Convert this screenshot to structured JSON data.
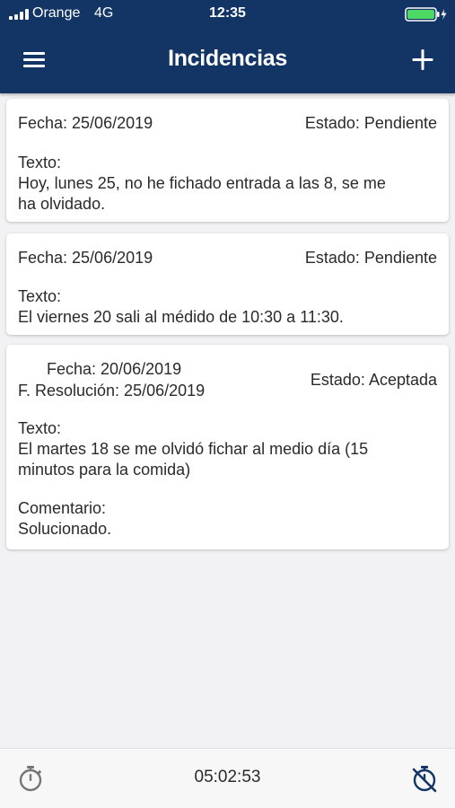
{
  "status_bar": {
    "carrier": "Orange",
    "network": "4G",
    "time": "12:35",
    "signal_icon": "signal-bars-icon",
    "battery_icon": "battery-charging-icon",
    "battery_color": "#4cd964"
  },
  "navbar": {
    "title": "Incidencias",
    "menu_icon": "hamburger-menu-icon",
    "add_icon": "plus-icon",
    "background": "#123566"
  },
  "incidents": [
    {
      "fecha": "Fecha: 25/06/2019",
      "estado": "Estado: Pendiente",
      "texto_label": "Texto:",
      "texto_line1": "Hoy, lunes 25, no he fichado entrada a las 8, se me",
      "texto_line2": "ha olvidado."
    },
    {
      "fecha": "Fecha: 25/06/2019",
      "estado": "Estado: Pendiente",
      "texto_label": "Texto:",
      "texto_line1": "El viernes 20 sali al médido de 10:30 a 11:30."
    },
    {
      "fecha": "Fecha: 20/06/2019",
      "resolucion": "F. Resolución: 25/06/2019",
      "estado": "Estado: Aceptada",
      "texto_label": "Texto:",
      "texto_line1": "El martes 18 se me olvidó fichar al medio día (15",
      "texto_line2": "minutos para la comida)",
      "comentario_label": "Comentario:",
      "comentario": "Solucionado."
    }
  ],
  "bottom_bar": {
    "clock": "05:02:53",
    "start_icon": "stopwatch-icon",
    "stop_icon": "stopwatch-off-icon"
  }
}
